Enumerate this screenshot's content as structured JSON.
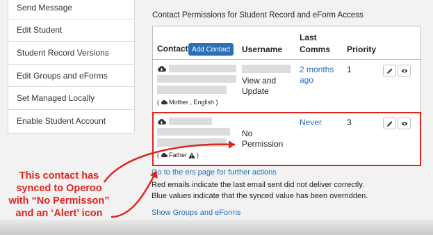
{
  "menu": {
    "items": [
      "Send Message",
      "Edit Student",
      "Student Record Versions",
      "Edit Groups and eForms",
      "Set Managed Locally",
      "Enable Student Account"
    ]
  },
  "section": {
    "title": "Contact Permissions for Student Record and eForm Access"
  },
  "table": {
    "headers": {
      "contact": "Contact",
      "add_contact": "Add Contact",
      "username": "Username",
      "last_comms_1": "Last",
      "last_comms_2": "Comms",
      "priority": "Priority"
    },
    "rows": [
      {
        "username_line1": "View and",
        "username_line2": "Update",
        "comms_line1": "2 months",
        "comms_line2": "ago",
        "priority": "1",
        "tag_open": "(",
        "tag_text": "Mother , English )"
      },
      {
        "username_line1": "No",
        "username_line2": "Permission",
        "comms_line1": "Never",
        "comms_line2": "",
        "priority": "3",
        "tag_open": "(",
        "tag_text": "Father",
        "tag_close": ")"
      }
    ]
  },
  "footer": {
    "link_pre": "Go to the ",
    "link_post": "ers page for further actions",
    "red_note": "Red emails indicate the last email sent did not deliver correctly.",
    "blue_note": "Blue values indicate that the synced value has been overridden.",
    "groups_link_pre": "Show",
    "groups_link_post": " Groups and eForms"
  },
  "callout": {
    "line1": "This contact has",
    "line2": "synced to Operoo",
    "line3": "with “No Permisson”",
    "line4": "and an ‘Alert’ icon"
  },
  "colors": {
    "accent": "#2a6fb8",
    "alert_red": "#e0241c"
  }
}
